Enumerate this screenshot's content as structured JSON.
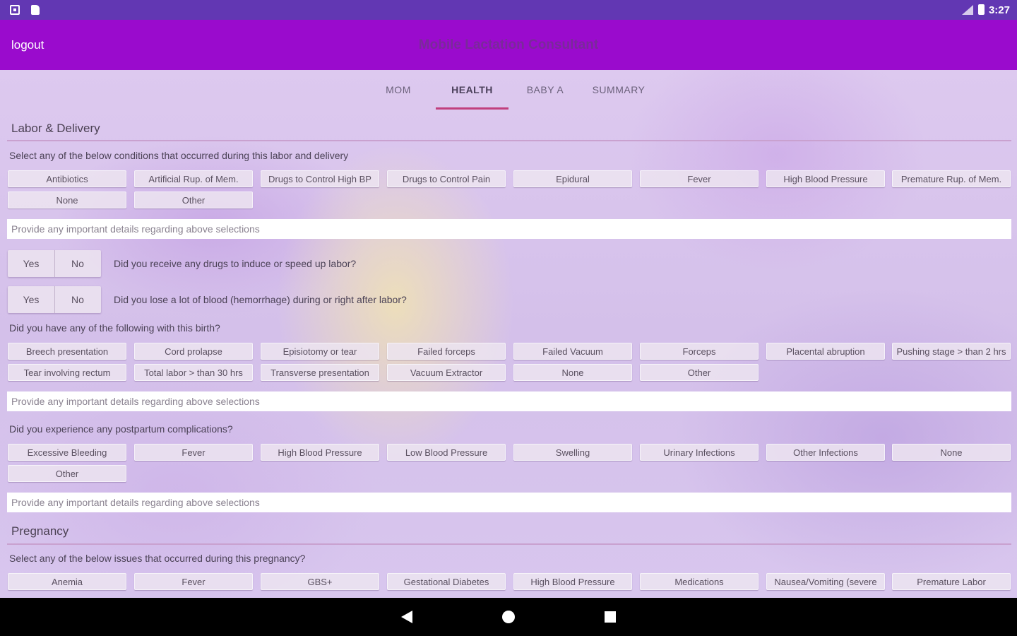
{
  "status_bar": {
    "time": "3:27"
  },
  "app_bar": {
    "logout": "logout",
    "title": "Mobile Lactation Consultant"
  },
  "tabs": [
    "MOM",
    "HEALTH",
    "BABY A",
    "SUMMARY"
  ],
  "active_tab": "HEALTH",
  "labor_delivery": {
    "title": "Labor & Delivery",
    "prompt": "Select any of the below conditions that occurred during this labor and delivery",
    "options": [
      "Antibiotics",
      "Artificial Rup. of Mem.",
      "Drugs to Control High BP",
      "Drugs to Control Pain",
      "Epidural",
      "Fever",
      "High Blood Pressure",
      "Premature Rup. of Mem.",
      "None",
      "Other"
    ],
    "details_placeholder": "Provide any important details regarding above selections",
    "q1": {
      "yes": "Yes",
      "no": "No",
      "question": "Did you receive any drugs to induce or speed up labor?"
    },
    "q2": {
      "yes": "Yes",
      "no": "No",
      "question": "Did you lose a lot of blood (hemorrhage) during or right after labor?"
    },
    "birth_prompt": "Did you have any of the following with this birth?",
    "birth_options": [
      "Breech presentation",
      "Cord prolapse",
      "Episiotomy or tear",
      "Failed forceps",
      "Failed Vacuum",
      "Forceps",
      "Placental abruption",
      "Pushing stage > than 2 hrs",
      "Tear involving rectum",
      "Total labor > than 30 hrs",
      "Transverse presentation",
      "Vacuum Extractor",
      "None",
      "Other"
    ],
    "birth_details_placeholder": "Provide any important details regarding above selections",
    "postpartum_prompt": "Did you experience any postpartum complications?",
    "postpartum_options": [
      "Excessive Bleeding",
      "Fever",
      "High Blood Pressure",
      "Low Blood Pressure",
      "Swelling",
      "Urinary Infections",
      "Other Infections",
      "None",
      "Other"
    ],
    "postpartum_details_placeholder": "Provide any important details regarding above selections"
  },
  "pregnancy": {
    "title": "Pregnancy",
    "prompt": "Select any of the below issues that occurred during this pregnancy?",
    "options": [
      "Anemia",
      "Fever",
      "GBS+",
      "Gestational Diabetes",
      "High Blood Pressure",
      "Medications",
      "Nausea/Vomiting (severe",
      "Premature Labor"
    ]
  }
}
